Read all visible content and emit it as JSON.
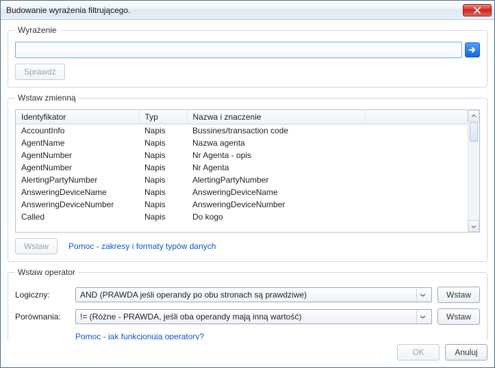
{
  "window": {
    "title": "Budowanie wyrażenia filtrującego."
  },
  "expression": {
    "legend": "Wyrażenie",
    "value": "",
    "check_label": "Sprawdź"
  },
  "variables": {
    "legend": "Wstaw zmienną",
    "columns": {
      "id": "Identyfikator",
      "type": "Typ",
      "desc": "Nazwa i znaczenie"
    },
    "rows": [
      {
        "id": "AccountInfo",
        "type": "Napis",
        "desc": "Bussines/transaction code"
      },
      {
        "id": "AgentName",
        "type": "Napis",
        "desc": "Nazwa agenta"
      },
      {
        "id": "AgentNumber",
        "type": "Napis",
        "desc": "Nr Agenta - opis"
      },
      {
        "id": "AgentNumber",
        "type": "Napis",
        "desc": "Nr Agenta"
      },
      {
        "id": "AlertingPartyNumber",
        "type": "Napis",
        "desc": "AlertingPartyNumber"
      },
      {
        "id": "AnsweringDeviceName",
        "type": "Napis",
        "desc": "AnsweringDeviceName"
      },
      {
        "id": "AnsweringDeviceNumber",
        "type": "Napis",
        "desc": "AnsweringDeviceNumber"
      },
      {
        "id": "Called",
        "type": "Napis",
        "desc": "Do kogo"
      }
    ],
    "insert_label": "Wstaw",
    "help_link": "Pomoc - zakresy i formaty typów danych"
  },
  "operators": {
    "legend": "Wstaw operator",
    "logical_label": "Logiczny:",
    "logical_value": "AND (PRAWDA jeśli operandy po obu stronach są prawdziwe)",
    "compare_label": "Porównania:",
    "compare_value": "!= (Różne - PRAWDA, jeśli oba operandy mają inną wartość)",
    "insert_label": "Wstaw",
    "help_link": "Pomoc - jak funkcjonują operatory?"
  },
  "footer": {
    "ok": "OK",
    "cancel": "Anuluj"
  }
}
